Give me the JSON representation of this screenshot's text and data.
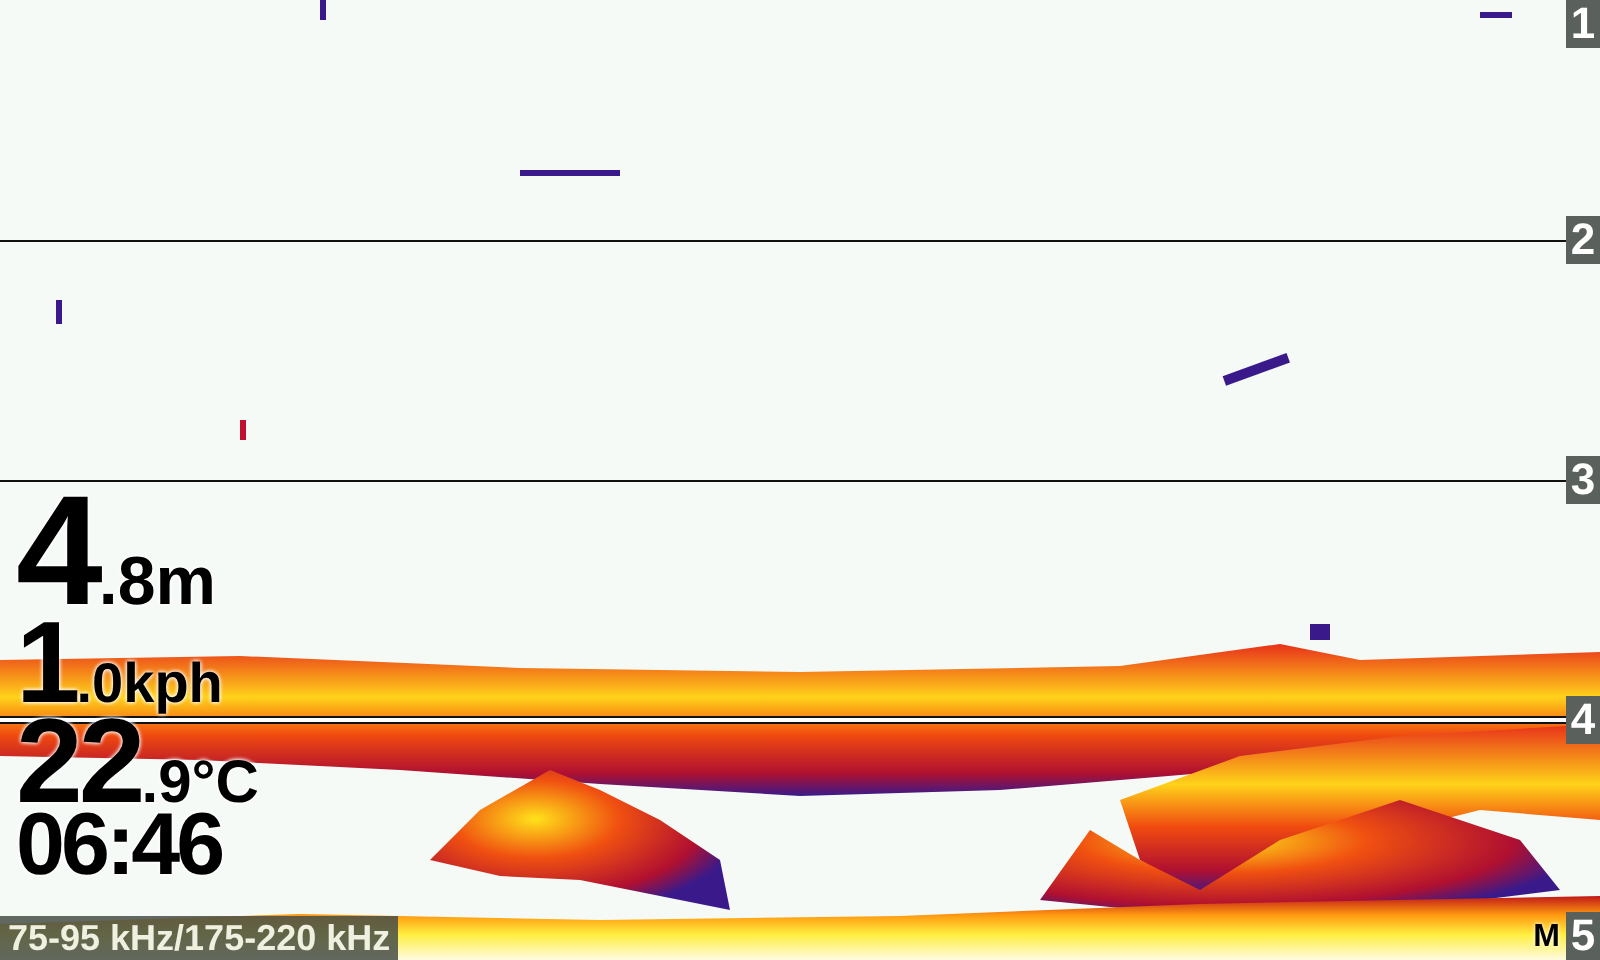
{
  "readouts": [
    {
      "kind": "depth",
      "whole": "4",
      "fraction": ".8",
      "unit": "m"
    },
    {
      "kind": "speed",
      "whole": "1",
      "fraction": ".0",
      "unit": "kph"
    },
    {
      "kind": "temperature",
      "whole": "22",
      "fraction": ".9",
      "unit": "°C"
    },
    {
      "kind": "time",
      "whole": "06:46"
    }
  ],
  "depth_scale": [
    "1",
    "2",
    "3",
    "4",
    "5"
  ],
  "frequency": "75-95 kHz/175-220 kHz",
  "mode": "M"
}
